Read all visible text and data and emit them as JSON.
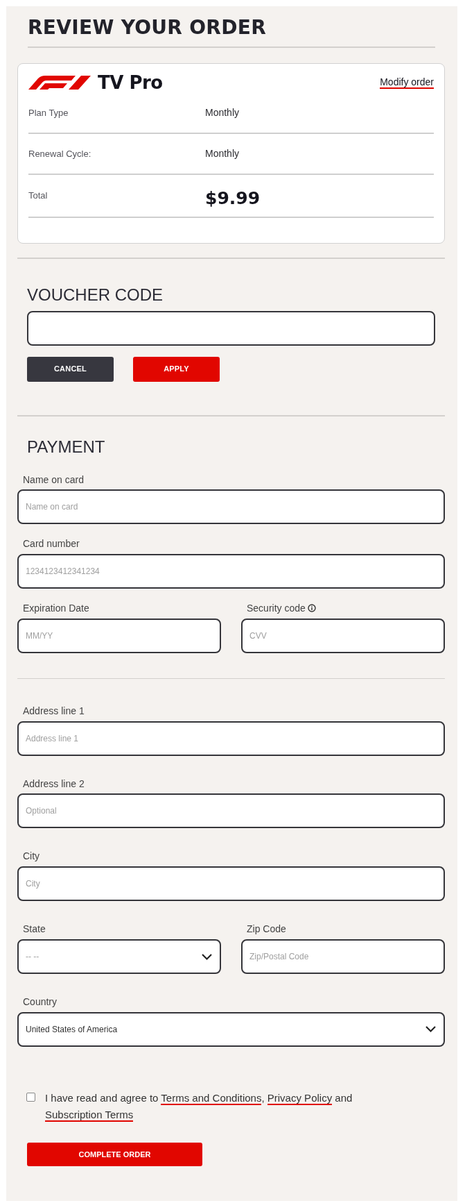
{
  "title": "REVIEW YOUR ORDER",
  "order": {
    "product": "TV Pro",
    "modify_link": "Modify order",
    "rows": [
      {
        "label": "Plan Type",
        "value": "Monthly",
        "kind": "plain"
      },
      {
        "label": "Renewal Cycle:",
        "value": "Monthly",
        "kind": "plain"
      },
      {
        "label": "Total",
        "value": "$9.99",
        "kind": "total"
      }
    ]
  },
  "voucher": {
    "heading": "VOUCHER CODE",
    "buttons": [
      {
        "label": "CANCEL",
        "kind": "secondary"
      },
      {
        "label": "APPLY",
        "kind": "primary"
      }
    ]
  },
  "payment": {
    "heading": "PAYMENT",
    "rows": [
      [
        {
          "label": "Name on card",
          "kind": "input",
          "placeholder": "Name on card"
        }
      ],
      [
        {
          "label": "Card number",
          "kind": "input",
          "placeholder": "1234123412341234"
        }
      ],
      [
        {
          "label": "Expiration Date",
          "kind": "input",
          "placeholder": "MM/YY"
        },
        {
          "label": "Security code",
          "kind": "input",
          "placeholder": "CVV",
          "info": true
        }
      ]
    ]
  },
  "address": {
    "rows": [
      [
        {
          "label": "Address line 1",
          "kind": "input",
          "placeholder": "Address line 1"
        }
      ],
      [
        {
          "label": "Address line 2",
          "kind": "input",
          "placeholder": "Optional"
        }
      ],
      [
        {
          "label": "City",
          "kind": "input",
          "placeholder": "City"
        }
      ],
      [
        {
          "label": "State",
          "kind": "select",
          "placeholder": "-- --"
        },
        {
          "label": "Zip Code",
          "kind": "input",
          "placeholder": "Zip/Postal Code"
        }
      ],
      [
        {
          "label": "Country",
          "kind": "select",
          "value": "United States of America"
        }
      ]
    ]
  },
  "agreement": {
    "checked": false,
    "parts": [
      {
        "kind": "text",
        "text": "I have read and agree to "
      },
      {
        "kind": "link",
        "text": "Terms and Conditions"
      },
      {
        "kind": "text",
        "text": ", "
      },
      {
        "kind": "link",
        "text": "Privacy Policy"
      },
      {
        "kind": "text",
        "text": " and "
      },
      {
        "kind": "link",
        "text": "Subscription Terms"
      }
    ]
  },
  "submit": {
    "label": "COMPLETE ORDER"
  }
}
